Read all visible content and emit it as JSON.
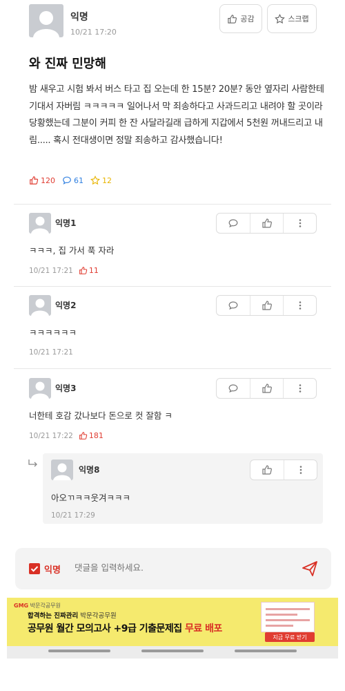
{
  "post": {
    "author": "익명",
    "time": "10/21 17:20",
    "like_button": "공감",
    "scrap_button": "스크랩",
    "title": "와 진짜 민망해",
    "body": "밤 새우고 시험 봐서 버스 타고 집 오는데 한 15분? 20분? 동안 옆자리 사람한테 기대서 자버림 ㅋㅋㅋㅋㅋ 일어나서 막 죄송하다고 사과드리고 내려야 할 곳이라 당황했는데 그분이 커피 한 잔 사달라길래 급하게 지갑에서 5천원 꺼내드리고 내림..... 혹시 전대생이면 정말 죄송하고 감사했습니다!",
    "likes": "120",
    "comments": "61",
    "scraps": "12"
  },
  "comments": [
    {
      "author": "익명1",
      "text": "ㅋㅋㅋ, 집 가서 푹 자라",
      "time": "10/21 17:21",
      "likes": "11"
    },
    {
      "author": "익명2",
      "text": "ㅋㅋㅋㅋㅋㅋ",
      "time": "10/21 17:21",
      "likes": ""
    },
    {
      "author": "익명3",
      "text": "너한테 호감 갔나보다 돈으로 컷 잘함 ㅋ",
      "time": "10/21 17:22",
      "likes": "181"
    }
  ],
  "reply": {
    "author": "익명8",
    "text": "아오ㄲㅋㅋ웃겨ㅋㅋㅋ",
    "time": "10/21 17:29"
  },
  "input": {
    "anon_label": "익명",
    "placeholder": "댓글을 입력하세요."
  },
  "ad": {
    "brand_logo": "GMG",
    "brand_name": "박문각공무원",
    "line1_prefix": "합격하는 진짜관리",
    "line1_suffix": " 박문각공무원",
    "line2_main": "공무원 월간 모의고사 +9급 기출문제집",
    "line2_accent": " 무료 배포",
    "cta": "지금 무료 받기"
  },
  "colors": {
    "accent_red": "#e03c31",
    "comment_blue": "#2f7fe0",
    "scrap_yellow": "#e8b400",
    "ad_yellow": "#f5ea6e"
  }
}
